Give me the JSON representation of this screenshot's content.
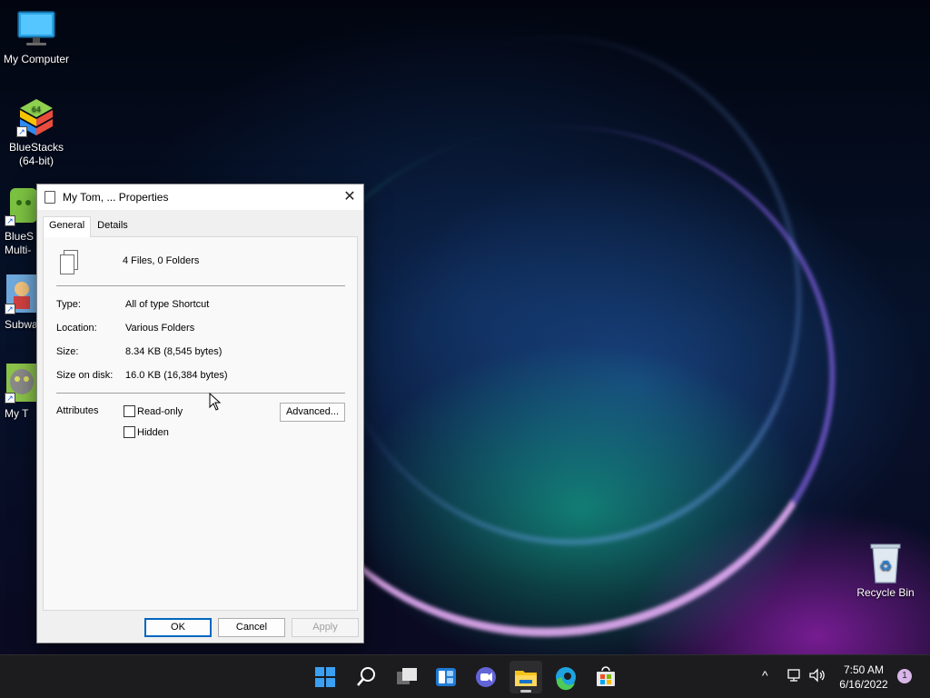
{
  "desktop": {
    "icons": [
      {
        "label": "My Computer",
        "icon": "monitor-icon"
      },
      {
        "label": "BlueStacks\n(64-bit)",
        "icon": "bluestacks-icon"
      },
      {
        "label": "BlueS\nMulti-",
        "icon": "bluestacks-multi-icon"
      },
      {
        "label": "Subwa",
        "icon": "subway-surfers-icon"
      },
      {
        "label": "My T",
        "icon": "my-talking-tom-icon"
      },
      {
        "label": "Recycle Bin",
        "icon": "recycle-bin-icon"
      }
    ]
  },
  "dialog": {
    "title": "My Tom, ... Properties",
    "close": "✕",
    "tabs": [
      "General",
      "Details"
    ],
    "active_tab": "General",
    "summary": "4 Files, 0 Folders",
    "fields": [
      {
        "label": "Type:",
        "value": "All of type Shortcut"
      },
      {
        "label": "Location:",
        "value": "Various Folders"
      },
      {
        "label": "Size:",
        "value": "8.34 KB (8,545 bytes)"
      },
      {
        "label": "Size on disk:",
        "value": "16.0 KB (16,384 bytes)"
      }
    ],
    "attributes_label": "Attributes",
    "readonly_label": "Read-only",
    "hidden_label": "Hidden",
    "readonly_checked": false,
    "hidden_checked": false,
    "advanced_label": "Advanced...",
    "ok_label": "OK",
    "cancel_label": "Cancel",
    "apply_label": "Apply"
  },
  "taskbar": {
    "items": [
      "windows-start-icon",
      "search-icon",
      "task-view-icon",
      "widgets-icon",
      "teams-chat-icon",
      "file-explorer-icon",
      "edge-icon",
      "store-icon"
    ],
    "active_item": "file-explorer-icon",
    "tray_chevron": "^",
    "time": "7:50 AM",
    "date": "6/16/2022",
    "notification_count": "1"
  },
  "colors": {
    "accent": "#0067c0",
    "taskbar_bg": "#1c1c1e",
    "dialog_bg": "#f0f0f0"
  }
}
